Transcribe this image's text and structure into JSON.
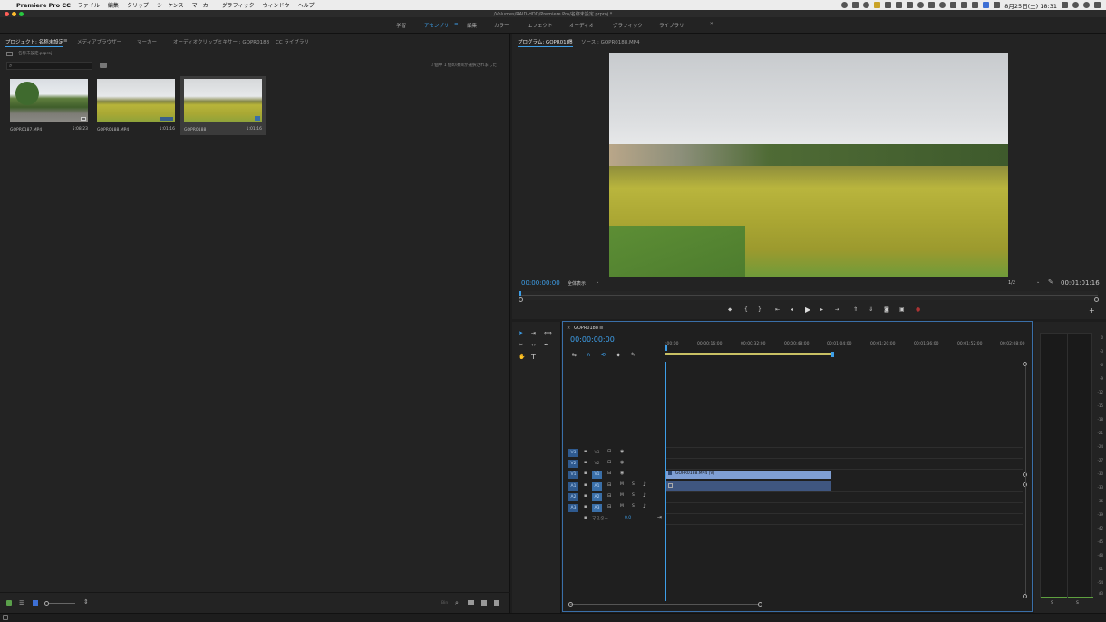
{
  "menubar": {
    "app": "Premiere Pro CC",
    "items": [
      "ファイル",
      "編集",
      "クリップ",
      "シーケンス",
      "マーカー",
      "グラフィック",
      "ウィンドウ",
      "ヘルプ"
    ],
    "clock": "8月25日(土) 18:31"
  },
  "window": {
    "title": "/Volumes/RAID-HDD/Premiere Pro/名称未設定.prproj *"
  },
  "workspaces": {
    "tabs": [
      "学習",
      "アセンブリ",
      "編集",
      "カラー",
      "エフェクト",
      "オーディオ",
      "グラフィック",
      "ライブラリ"
    ],
    "active": "アセンブリ",
    "more": "»"
  },
  "project": {
    "tabs": [
      "プロジェクト: 名称未設定",
      "メディアブラウザー",
      "マーカー",
      "オーディオクリップミキサー : GOPR0188",
      "CC ライブラリ"
    ],
    "breadcrumb": "名称未設定.prproj",
    "selection_status": "3 個中 1 個の項目が選択されました",
    "items": [
      {
        "name": "GOPR0187.MP4",
        "duration": "5:08:23"
      },
      {
        "name": "GOPR0188.MP4",
        "duration": "1:01:16"
      },
      {
        "name": "GOPR0188",
        "duration": "1:01:16"
      }
    ],
    "footer_size": "Bin"
  },
  "program": {
    "tabs": [
      "プログラム: GOPR0188",
      "ソース : GOPR0188.MP4"
    ],
    "timecode": "00:00:00:00",
    "fit": "全体表示",
    "resolution": "1/2",
    "duration": "00:01:01:16"
  },
  "timeline": {
    "sequence": "GOPR0188",
    "timecode": "00:00:00:00",
    "ruler": [
      ":00:00",
      "00:00:16:00",
      "00:00:32:00",
      "00:00:48:00",
      "00:01:04:00",
      "00:01:20:00",
      "00:01:36:00",
      "00:01:52:00",
      "00:02:08:00"
    ],
    "video_tracks": [
      "V3",
      "V2",
      "V1"
    ],
    "audio_tracks": [
      "A1",
      "A2",
      "A3"
    ],
    "master": "マスター",
    "master_value": "0.0",
    "clip_label": "GOPR0188.MP4 [V]"
  },
  "meter": {
    "scale": [
      "0",
      "-3",
      "-6",
      "-9",
      "-12",
      "-15",
      "-18",
      "-21",
      "-24",
      "-27",
      "-30",
      "-33",
      "-36",
      "-39",
      "-42",
      "-45",
      "-48",
      "-51",
      "-54",
      "dB"
    ],
    "solo": [
      "S",
      "S"
    ]
  },
  "colors": {
    "accent": "#3d9ee8",
    "clip_video": "#7f9fd4",
    "clip_audio": "#3f5680",
    "work_area": "#c8c064"
  }
}
